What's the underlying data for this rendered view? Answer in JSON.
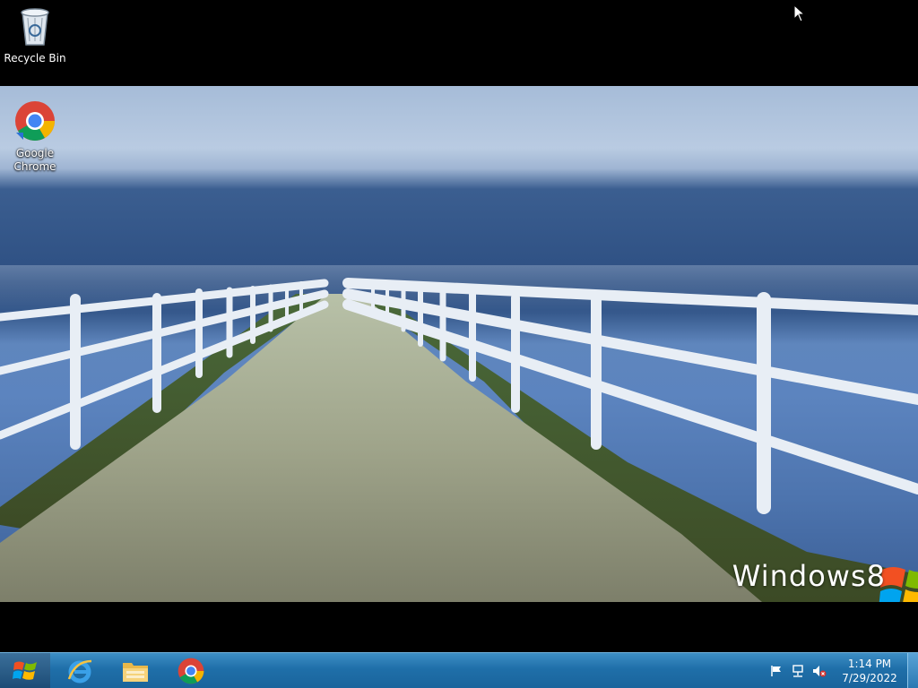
{
  "desktop": {
    "icons": [
      {
        "label": "Recycle Bin",
        "icon": "recycle-bin-icon"
      },
      {
        "label": "Google\nChrome",
        "icon": "chrome-icon"
      }
    ]
  },
  "wallpaper": {
    "brand_text": "Windows8"
  },
  "taskbar": {
    "start_icon": "windows-logo-icon",
    "pinned": [
      {
        "name": "Internet Explorer",
        "icon": "internet-explorer-icon"
      },
      {
        "name": "File Explorer",
        "icon": "folder-icon"
      },
      {
        "name": "Google Chrome",
        "icon": "chrome-icon"
      }
    ],
    "tray": {
      "icons": [
        "flag-icon",
        "network-icon",
        "volume-muted-icon"
      ],
      "time": "1:14 PM",
      "date": "7/29/2022"
    }
  },
  "colors": {
    "taskbar": "#1f6fa9",
    "desktop_background": "#000000"
  }
}
